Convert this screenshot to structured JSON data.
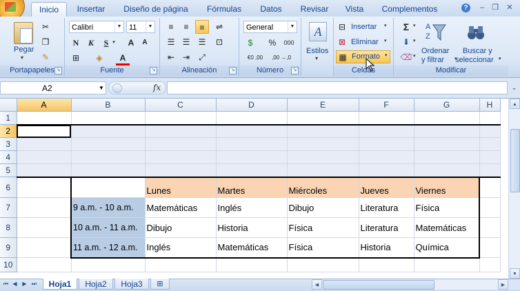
{
  "tabs": [
    "Inicio",
    "Insertar",
    "Diseño de página",
    "Fórmulas",
    "Datos",
    "Revisar",
    "Vista",
    "Complementos"
  ],
  "ribbon": {
    "clipboard": {
      "paste": "Pegar",
      "label": "Portapapeles"
    },
    "font": {
      "name": "Calibri",
      "size": "11",
      "bold": "N",
      "italic": "K",
      "underline": "S",
      "grow": "A",
      "shrink": "A",
      "color_a": "A",
      "label": "Fuente"
    },
    "alignment": {
      "label": "Alineación"
    },
    "number": {
      "format": "General",
      "percent": "%",
      "thousands": "000",
      "inc_dec": "€0 ,00",
      "dec_dec": ",00 →,0",
      "label": "Número"
    },
    "styles": {
      "label": "Estilos"
    },
    "cells": {
      "insert": "Insertar",
      "delete": "Eliminar",
      "format": "Formato",
      "label": "Celdas"
    },
    "editing": {
      "sigma": "Σ",
      "sort": "Ordenar",
      "sort2": "y filtrar",
      "find": "Buscar y",
      "find2": "seleccionar",
      "label": "Modificar"
    }
  },
  "name_box": "A2",
  "fx": "fx",
  "columns": [
    "A",
    "B",
    "C",
    "D",
    "E",
    "F",
    "G",
    "H"
  ],
  "rows": [
    "1",
    "2",
    "3",
    "4",
    "5",
    "6",
    "7",
    "8",
    "9",
    "10"
  ],
  "schedule": {
    "days": [
      "Lunes",
      "Martes",
      "Miércoles",
      "Jueves",
      "Viernes"
    ],
    "slots": [
      {
        "time": "9 a.m. - 10 a.m.",
        "classes": [
          "Matemáticas",
          "Inglés",
          "Dibujo",
          "Literatura",
          "Física"
        ]
      },
      {
        "time": "10 a.m. - 11 a.m.",
        "classes": [
          "Dibujo",
          "Historia",
          "Física",
          "Literatura",
          "Matemáticas"
        ]
      },
      {
        "time": "11 a.m. - 12 a.m.",
        "classes": [
          "Inglés",
          "Matemáticas",
          "Física",
          "Historia",
          "Química"
        ]
      }
    ]
  },
  "sheets": [
    "Hoja1",
    "Hoja2",
    "Hoja3"
  ],
  "colors": {
    "accent": "#15428b",
    "header_fill": "#fbd4b4",
    "time_fill": "#b8cce4",
    "shade_fill": "#e8ecf6"
  }
}
